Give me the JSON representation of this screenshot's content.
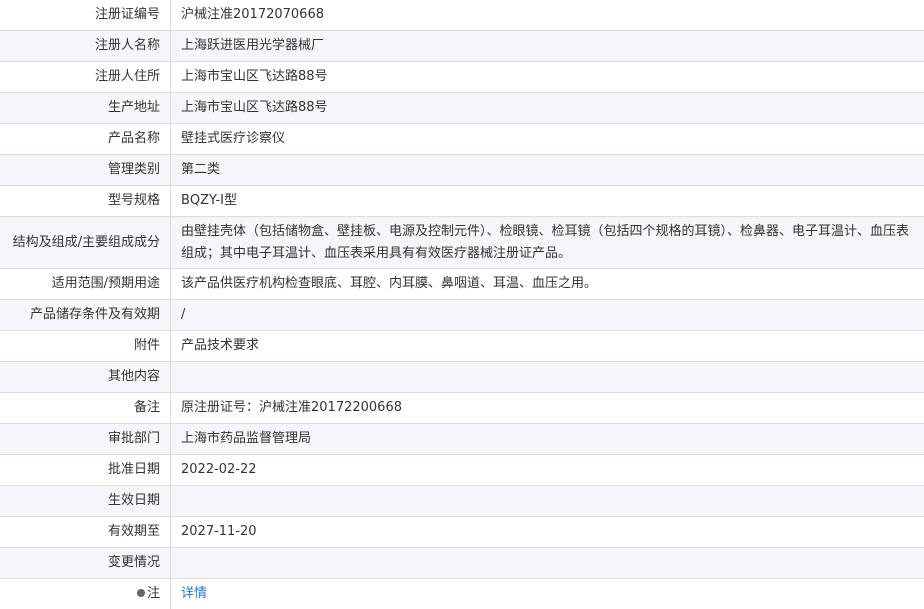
{
  "rows": [
    {
      "label": "注册证编号",
      "value": "沪械注准20172070668"
    },
    {
      "label": "注册人名称",
      "value": "上海跃进医用光学器械厂"
    },
    {
      "label": "注册人住所",
      "value": "上海市宝山区飞达路88号"
    },
    {
      "label": "生产地址",
      "value": "上海市宝山区飞达路88号"
    },
    {
      "label": "产品名称",
      "value": "壁挂式医疗诊察仪"
    },
    {
      "label": "管理类别",
      "value": "第二类"
    },
    {
      "label": "型号规格",
      "value": "BQZY-I型"
    },
    {
      "label": "结构及组成/主要组成成分",
      "value": "由壁挂壳体（包括储物盒、壁挂板、电源及控制元件）、检眼镜、检耳镜（包括四个规格的耳镜）、检鼻器、电子耳温计、血压表组成；其中电子耳温计、血压表采用具有有效医疗器械注册证产品。"
    },
    {
      "label": "适用范围/预期用途",
      "value": "该产品供医疗机构检查眼底、耳腔、内耳膜、鼻咽道、耳温、血压之用。"
    },
    {
      "label": "产品储存条件及有效期",
      "value": "/"
    },
    {
      "label": "附件",
      "value": "产品技术要求"
    },
    {
      "label": "其他内容",
      "value": ""
    },
    {
      "label": "备注",
      "value": "原注册证号：沪械注准20172200668"
    },
    {
      "label": "审批部门",
      "value": "上海市药品监督管理局"
    },
    {
      "label": "批准日期",
      "value": "2022-02-22"
    },
    {
      "label": "生效日期",
      "value": ""
    },
    {
      "label": "有效期至",
      "value": "2027-11-20"
    },
    {
      "label": "变更情况",
      "value": ""
    },
    {
      "label": "注",
      "value": "详情"
    }
  ]
}
